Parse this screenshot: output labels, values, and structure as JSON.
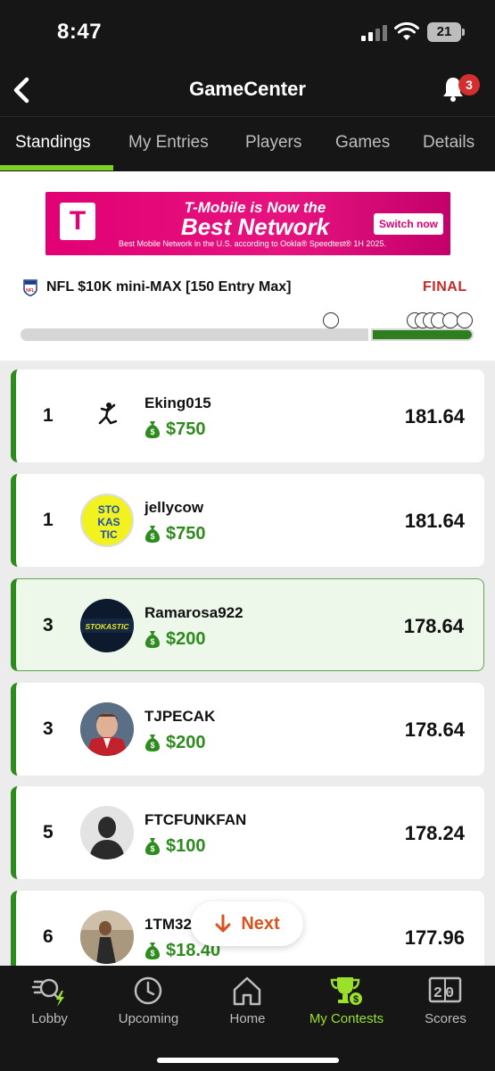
{
  "status": {
    "time": "8:47",
    "battery": "21"
  },
  "header": {
    "title": "GameCenter",
    "notifications": "3"
  },
  "tabs": [
    {
      "label": "Standings",
      "active": true
    },
    {
      "label": "My Entries"
    },
    {
      "label": "Players"
    },
    {
      "label": "Games"
    },
    {
      "label": "Details"
    }
  ],
  "ad": {
    "logo": "T",
    "line1": "T-Mobile is Now the",
    "line2": "Best Network",
    "line3": "Best Mobile Network in the U.S. according to Ookla® Speedtest® 1H 2025.",
    "button": "Switch now",
    "brand_color": "#e20074"
  },
  "contest": {
    "name": "NFL $10K mini-MAX [150 Entry Max]",
    "status": "FINAL"
  },
  "standings": [
    {
      "rank": "1",
      "username": "Eking015",
      "prize": "$750",
      "score": "181.64",
      "avatar": "jordan-logo-avatar"
    },
    {
      "rank": "1",
      "username": "jellycow",
      "prize": "$750",
      "score": "181.64",
      "avatar": "stokastic-yellow-avatar",
      "avatar_text": [
        "STO",
        "KAS",
        "TIC"
      ]
    },
    {
      "rank": "3",
      "username": "Ramarosa922",
      "prize": "$200",
      "score": "178.64",
      "avatar": "stokastic-dark-avatar",
      "avatar_text": "STOKASTIC",
      "highlighted": true
    },
    {
      "rank": "3",
      "username": "TJPECAK",
      "prize": "$200",
      "score": "178.64",
      "avatar": "photo-avatar"
    },
    {
      "rank": "5",
      "username": "FTCFUNKFAN",
      "prize": "$100",
      "score": "178.24",
      "avatar": "default-silhouette-avatar"
    },
    {
      "rank": "6",
      "username": "1TM32",
      "prize": "$18.40",
      "score": "177.96",
      "avatar": "photo-avatar"
    }
  ],
  "next_button": "Next",
  "bottom_nav": [
    {
      "label": "Lobby",
      "icon": "lobby-icon"
    },
    {
      "label": "Upcoming",
      "icon": "clock-icon"
    },
    {
      "label": "Home",
      "icon": "home-icon"
    },
    {
      "label": "My Contests",
      "icon": "trophy-icon",
      "active": true
    },
    {
      "label": "Scores",
      "icon": "scoreboard-icon",
      "icon_text": "20"
    }
  ],
  "colors": {
    "accent": "#7ed321",
    "prize_green": "#2e8b1e",
    "final_red": "#c62828",
    "next_orange": "#d9531e",
    "dark_bg": "#161616"
  }
}
